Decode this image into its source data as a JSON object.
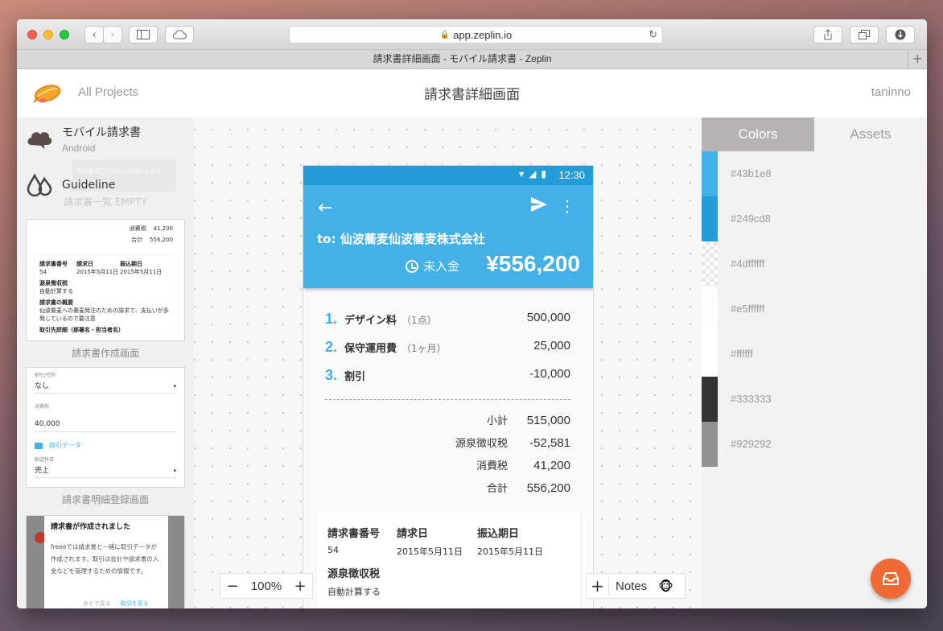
{
  "browser": {
    "url": "app.zeplin.io",
    "tab_title": "請求書詳細画面 - モバイル請求書 - Zeplin"
  },
  "header": {
    "all_projects": "All Projects",
    "screen_title": "請求書詳細画面",
    "username": "taninno"
  },
  "sidebar": {
    "projects": [
      {
        "name": "モバイル請求書",
        "platform": "Android",
        "icon": "cloud-icon"
      },
      {
        "name": "Guideline",
        "icon": "drops-icon"
      }
    ],
    "ghost_label": "請求書一覧 EMPTY",
    "ghost_text": "請求書はこちらから作成できます",
    "screens": [
      {
        "label": "請求書作成画面",
        "preview": {
          "rows": [
            [
              "消費税",
              "41,200"
            ],
            [
              "合計",
              "556,200"
            ]
          ],
          "heads": [
            "請求書番号",
            "請求日",
            "振込期日"
          ],
          "vals": [
            "54",
            "2015年5月11日",
            "2015年5月11日"
          ],
          "section1": "源泉徴収税",
          "section1_val": "自動計算する",
          "section2": "請求書の概要",
          "section2_val": "仙波蕎麦への蕎麦発注のための請求で、支払いが多発しているので要注意",
          "section3": "取引先詳細（部署名・担当者名）"
        }
      },
      {
        "label": "請求書明細登録画面",
        "preview": {
          "f1_label": "割引/控除",
          "f1_value": "なし",
          "f2_label": "消費税",
          "f2_value": "40,000",
          "link": "取引データ",
          "f3_label": "勘定科目",
          "f3_value": "売上"
        }
      },
      {
        "label": "",
        "preview": {
          "title": "請求書が作成されました",
          "body": "freeeでは請求書と一緒に取引データが作成されます。取引は会計や請求書の入金などを管理するための情報です。",
          "btn1": "あとで見る",
          "btn2": "取引を見る"
        }
      }
    ]
  },
  "phone": {
    "status_time": "12:30",
    "to": "to: 仙波蕎麦仙波蕎麦株式会社",
    "status": "未入金",
    "amount": "¥556,200",
    "items": [
      {
        "no": "1.",
        "name": "デザイン料",
        "qty": "（1点）",
        "amount": "500,000"
      },
      {
        "no": "2.",
        "name": "保守運用費",
        "qty": "（1ヶ月）",
        "amount": "25,000"
      },
      {
        "no": "3.",
        "name": "割引",
        "qty": "",
        "amount": "-10,000"
      }
    ],
    "totals": [
      {
        "label": "小計",
        "value": "515,000"
      },
      {
        "label": "源泉徴収税",
        "value": "-52,581"
      },
      {
        "label": "消費税",
        "value": "41,200"
      },
      {
        "label": "合計",
        "value": "556,200"
      }
    ],
    "info": {
      "invoice_no_label": "請求書番号",
      "invoice_no": "54",
      "invoice_date_label": "請求日",
      "invoice_date": "2015年5月11日",
      "due_date_label": "振込期日",
      "due_date": "2015年5月11日",
      "withholding_label": "源泉徴収税",
      "withholding_value": "自動計算する"
    }
  },
  "controls": {
    "zoom_minus": "−",
    "zoom_value": "100%",
    "zoom_plus": "+",
    "notes_plus": "+",
    "notes_label": "Notes",
    "notes_emoji": "🐵"
  },
  "rightpanel": {
    "tab_colors": "Colors",
    "tab_assets": "Assets",
    "colors": [
      {
        "label": "#43b1e8",
        "hex": "#43b1e8",
        "alpha": 1
      },
      {
        "label": "#249cd8",
        "hex": "#249cd8",
        "alpha": 1
      },
      {
        "label": "#4dffffff",
        "hex": "#ffffff",
        "alpha": 0.3
      },
      {
        "label": "#e5ffffff",
        "hex": "#ffffff",
        "alpha": 0.9
      },
      {
        "label": "#ffffff",
        "hex": "#ffffff",
        "alpha": 1
      },
      {
        "label": "#333333",
        "hex": "#333333",
        "alpha": 1
      },
      {
        "label": "#929292",
        "hex": "#929292",
        "alpha": 1
      }
    ]
  }
}
